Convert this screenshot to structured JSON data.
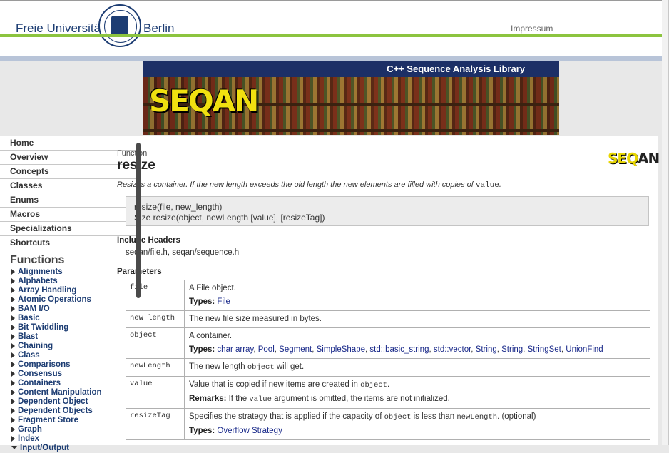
{
  "header": {
    "university_left": "Freie Universität",
    "university_right": "Berlin",
    "impressum_label": "Impressum"
  },
  "banner": {
    "tagline": "C++ Sequence Analysis Library",
    "logo_text": "SEQAN"
  },
  "sidebar": {
    "items": [
      {
        "label": "Home"
      },
      {
        "label": "Overview"
      },
      {
        "label": "Concepts"
      },
      {
        "label": "Classes"
      },
      {
        "label": "Enums"
      },
      {
        "label": "Macros"
      },
      {
        "label": "Specializations"
      },
      {
        "label": "Shortcuts"
      }
    ],
    "functions_heading": "Functions",
    "functions": [
      {
        "label": "Alignments"
      },
      {
        "label": "Alphabets"
      },
      {
        "label": "Array Handling"
      },
      {
        "label": "Atomic Operations"
      },
      {
        "label": "BAM I/O"
      },
      {
        "label": "Basic"
      },
      {
        "label": "Bit Twiddling"
      },
      {
        "label": "Blast"
      },
      {
        "label": "Chaining"
      },
      {
        "label": "Class"
      },
      {
        "label": "Comparisons"
      },
      {
        "label": "Consensus"
      },
      {
        "label": "Containers"
      },
      {
        "label": "Content Manipulation"
      },
      {
        "label": "Dependent Object"
      },
      {
        "label": "Dependent Objects"
      },
      {
        "label": "Fragment Store"
      },
      {
        "label": "Graph"
      },
      {
        "label": "Index"
      },
      {
        "label": "Input/Output"
      }
    ]
  },
  "page": {
    "kind": "Function",
    "title": "resize",
    "description_prefix": "Resizes a container. If the new length exceeds the old length the new elements are filled with copies of ",
    "description_code": "value",
    "description_suffix": ".",
    "signature_1": "resize(file, new_length)",
    "signature_2": "Size resize(object, newLength [value], [resizeTag])",
    "include_heading": "Include Headers",
    "include_value": "seqan/file.h, seqan/sequence.h",
    "params_heading": "Parameters",
    "mini_logo_a": "SEQ",
    "mini_logo_b": "AN"
  },
  "params": {
    "file": {
      "name": "file",
      "desc": "A File object.",
      "types_label": "Types:",
      "types": [
        "File"
      ]
    },
    "new_length": {
      "name": "new_length",
      "desc": "The new file size measured in bytes."
    },
    "object": {
      "name": "object",
      "desc": "A container.",
      "types_label": "Types:",
      "types": [
        "char array",
        "Pool",
        "Segment",
        "SimpleShape",
        "std::basic_string",
        "std::vector",
        "String",
        "String",
        "StringSet",
        "UnionFind"
      ]
    },
    "newLength": {
      "name": "newLength",
      "desc_prefix": "The new length ",
      "desc_code": "object",
      "desc_suffix": " will get."
    },
    "value": {
      "name": "value",
      "desc_prefix": "Value that is copied if new items are created in ",
      "desc_code": "object",
      "desc_suffix": ".",
      "remarks_label": "Remarks:",
      "remarks_prefix": " If the ",
      "remarks_code": "value",
      "remarks_suffix": " argument is omitted, the items are not initialized."
    },
    "resizeTag": {
      "name": "resizeTag",
      "desc_prefix": "Specifies the strategy that is applied if the capacity of ",
      "desc_code1": "object",
      "desc_mid": " is less than ",
      "desc_code2": "newLength",
      "desc_suffix": ". (optional)",
      "types_label": "Types:",
      "types": [
        "Overflow Strategy"
      ]
    }
  },
  "colors": {
    "accent_green": "#8cc43f",
    "fu_blue": "#1d3d73",
    "banner_blue": "#1c2f66",
    "link": "#1a2a8a",
    "logo_yellow": "#f0e010"
  }
}
